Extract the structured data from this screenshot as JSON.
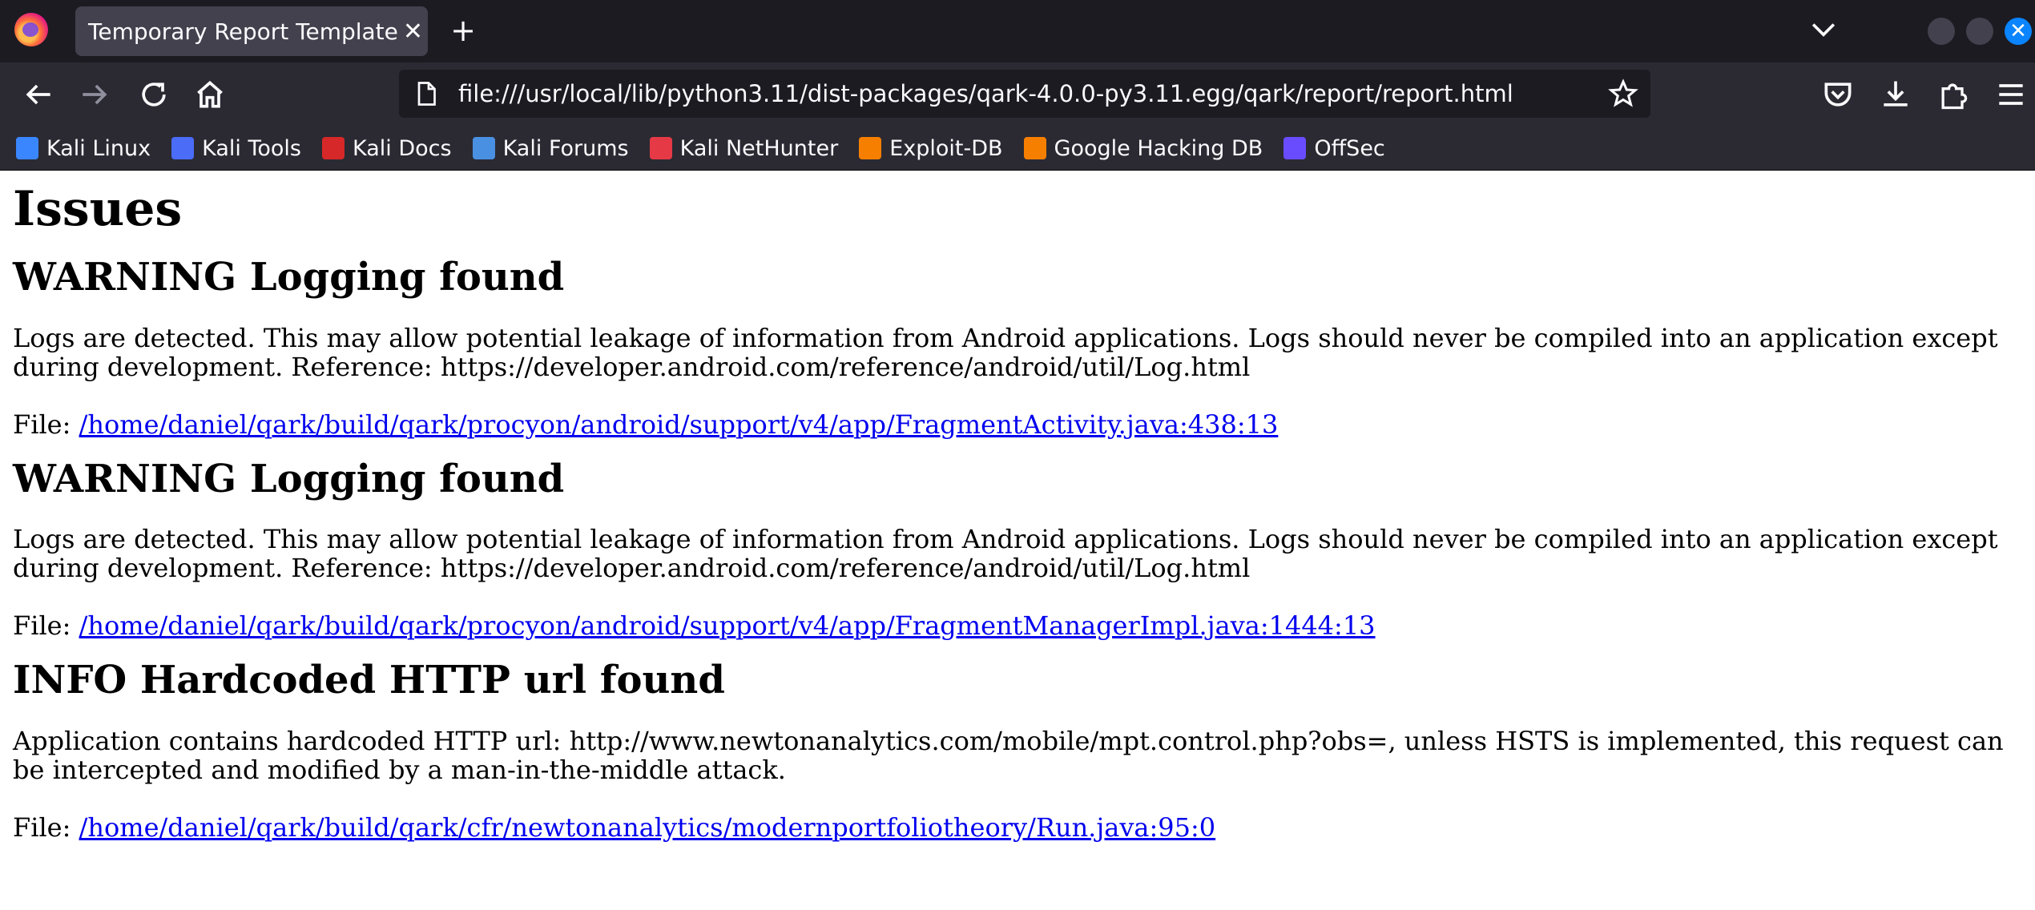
{
  "browser": {
    "tab": {
      "title": "Temporary Report Template",
      "close_symbol": "✕"
    },
    "new_tab_symbol": "+",
    "url": "file:///usr/local/lib/python3.11/dist-packages/qark-4.0.0-py3.11.egg/qark/report/report.html",
    "close_window_symbol": "✕",
    "bookmarks": [
      {
        "label": "Kali Linux",
        "icon": "kali-linux-icon",
        "color": "#3a86ff"
      },
      {
        "label": "Kali Tools",
        "icon": "kali-tools-icon",
        "color": "#4a6cf7"
      },
      {
        "label": "Kali Docs",
        "icon": "kali-docs-icon",
        "color": "#d62828"
      },
      {
        "label": "Kali Forums",
        "icon": "kali-forums-icon",
        "color": "#4a90e2"
      },
      {
        "label": "Kali NetHunter",
        "icon": "kali-nethunter-icon",
        "color": "#e63946"
      },
      {
        "label": "Exploit-DB",
        "icon": "exploit-db-icon",
        "color": "#f77f00"
      },
      {
        "label": "Google Hacking DB",
        "icon": "ghdb-icon",
        "color": "#f77f00"
      },
      {
        "label": "OffSec",
        "icon": "offsec-icon",
        "color": "#6a4cff"
      }
    ]
  },
  "page": {
    "heading": "Issues",
    "file_prefix": "File:",
    "issues": [
      {
        "title": "WARNING Logging found",
        "description": "Logs are detected. This may allow potential leakage of information from Android applications. Logs should never be compiled into an application except during development. Reference: https://developer.android.com/reference/android/util/Log.html",
        "file": "/home/daniel/qark/build/qark/procyon/android/support/v4/app/FragmentActivity.java:438:13"
      },
      {
        "title": "WARNING Logging found",
        "description": "Logs are detected. This may allow potential leakage of information from Android applications. Logs should never be compiled into an application except during development. Reference: https://developer.android.com/reference/android/util/Log.html",
        "file": "/home/daniel/qark/build/qark/procyon/android/support/v4/app/FragmentManagerImpl.java:1444:13"
      },
      {
        "title": "INFO Hardcoded HTTP url found",
        "description": "Application contains hardcoded HTTP url: http://www.newtonanalytics.com/mobile/mpt.control.php?obs=, unless HSTS is implemented, this request can be intercepted and modified by a man-in-the-middle attack.",
        "file": "/home/daniel/qark/build/qark/cfr/newtonanalytics/modernportfoliotheory/Run.java:95:0"
      }
    ]
  }
}
